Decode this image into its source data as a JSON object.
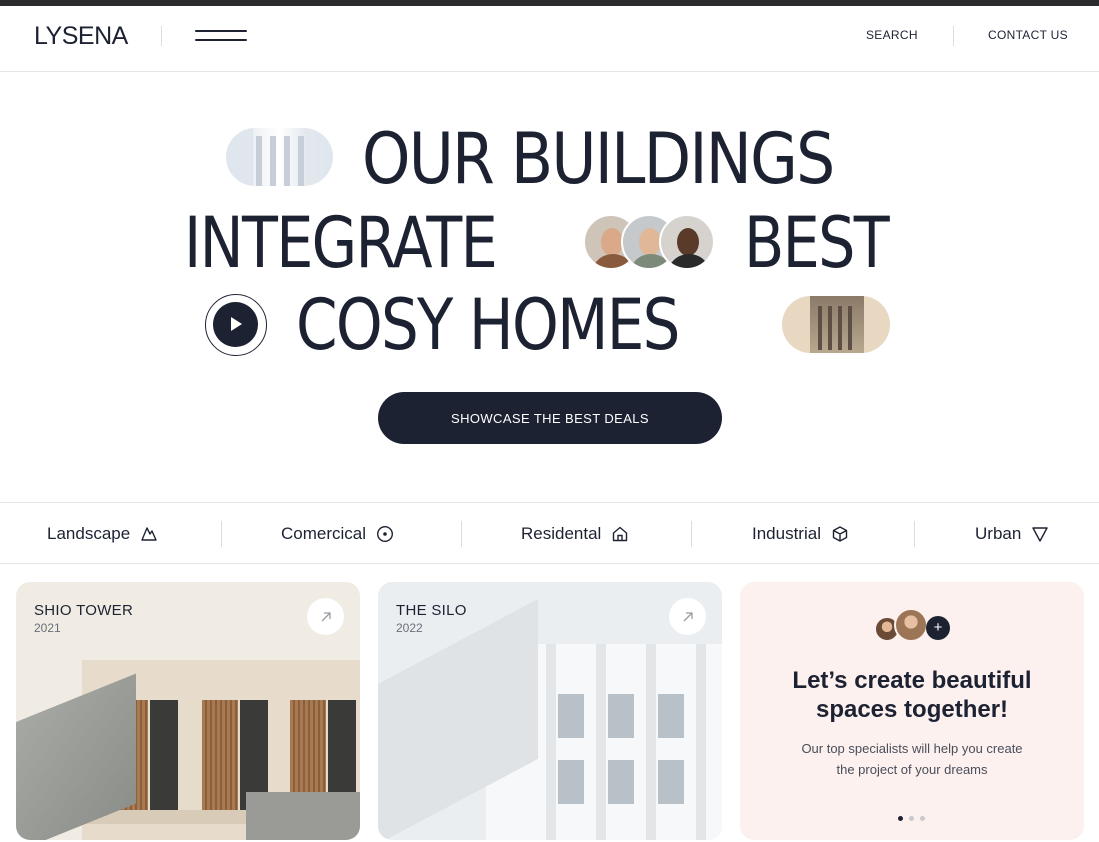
{
  "header": {
    "logo": "LYSENA",
    "nav": {
      "search": "SEARCH",
      "contact": "CONTACT US"
    }
  },
  "hero": {
    "line1": "OUR BUILDINGS",
    "line2a": "INTEGRATE",
    "line2b": "BEST",
    "line3": "COSY HOMES",
    "cta": "SHOWCASE THE BEST DEALS"
  },
  "categories": [
    {
      "label": "Landscape",
      "icon": "mountain-icon"
    },
    {
      "label": "Comercical",
      "icon": "target-icon"
    },
    {
      "label": "Residental",
      "icon": "home-icon"
    },
    {
      "label": "Industrial",
      "icon": "cube-icon"
    },
    {
      "label": "Urban",
      "icon": "triangle-down-icon"
    }
  ],
  "cards": [
    {
      "title": "SHIO TOWER",
      "year": "2021"
    },
    {
      "title": "THE SILO",
      "year": "2022"
    }
  ],
  "promo": {
    "heading_line1": "Let’s create beautiful",
    "heading_line2": "spaces together!",
    "text_line1": "Our top specialists will help you create",
    "text_line2": "the project of your dreams",
    "plus": "+"
  },
  "colors": {
    "primary": "#1d2233",
    "card1_bg": "#f1ece3",
    "card2_bg": "#eaeef1",
    "card3_bg": "#fcf1ef"
  }
}
